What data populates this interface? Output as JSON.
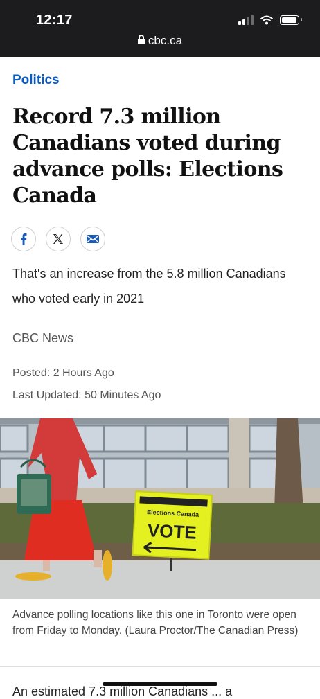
{
  "status_bar": {
    "time": "12:17"
  },
  "browser": {
    "url": "cbc.ca"
  },
  "article": {
    "section": "Politics",
    "headline": "Record 7.3 million Canadians voted during advance polls: Elections Canada",
    "deck": "That's an increase from the 5.8 million Canadians who voted early in 2021",
    "byline": "CBC News",
    "posted": "Posted: 2 Hours Ago",
    "updated": "Last Updated: 50 Minutes Ago",
    "share": [
      "facebook-icon",
      "x-icon",
      "email-icon"
    ],
    "photo": {
      "sign_brand": "Elections Canada",
      "sign_word": "VOTE",
      "caption": "Advance polling locations like this one in Toronto were open from Friday to Monday. (Laura Proctor/The Canadian Press)"
    },
    "body_start": "An estimated 7.3 million Canadians ... a"
  },
  "colors": {
    "section": "#0b5cc0",
    "topbar": "#1c1c1e",
    "sign": "#e4f020"
  }
}
